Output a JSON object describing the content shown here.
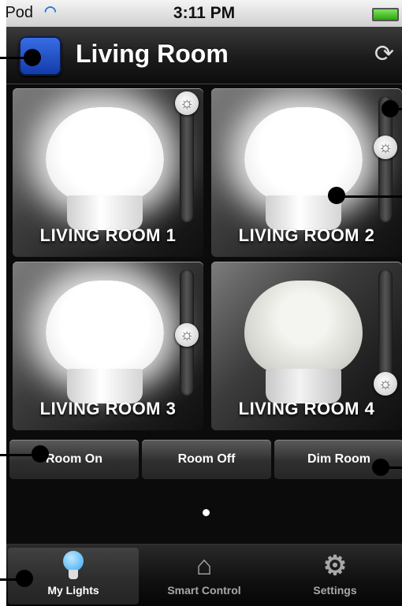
{
  "status_bar": {
    "carrier": "iPod",
    "time": "3:11 PM"
  },
  "header": {
    "title": "Living Room",
    "color_swatch": "#1f4fcf"
  },
  "tiles": [
    {
      "label": "LIVING ROOM 1",
      "state": "on",
      "brightness": 1.0
    },
    {
      "label": "LIVING ROOM 2",
      "state": "on",
      "brightness": 0.6
    },
    {
      "label": "LIVING ROOM 3",
      "state": "on",
      "brightness": 0.4
    },
    {
      "label": "LIVING ROOM 4",
      "state": "off",
      "brightness": 0.0
    }
  ],
  "actions": {
    "room_on": "Room On",
    "room_off": "Room Off",
    "dim_room": "Dim Room"
  },
  "pager": {
    "pages": 1,
    "current": 1
  },
  "tabs": [
    {
      "label": "My Lights",
      "icon": "lightbulb-icon",
      "active": true
    },
    {
      "label": "Smart Control",
      "icon": "house-gear-icon",
      "active": false
    },
    {
      "label": "Settings",
      "icon": "gear-icon",
      "active": false
    }
  ]
}
